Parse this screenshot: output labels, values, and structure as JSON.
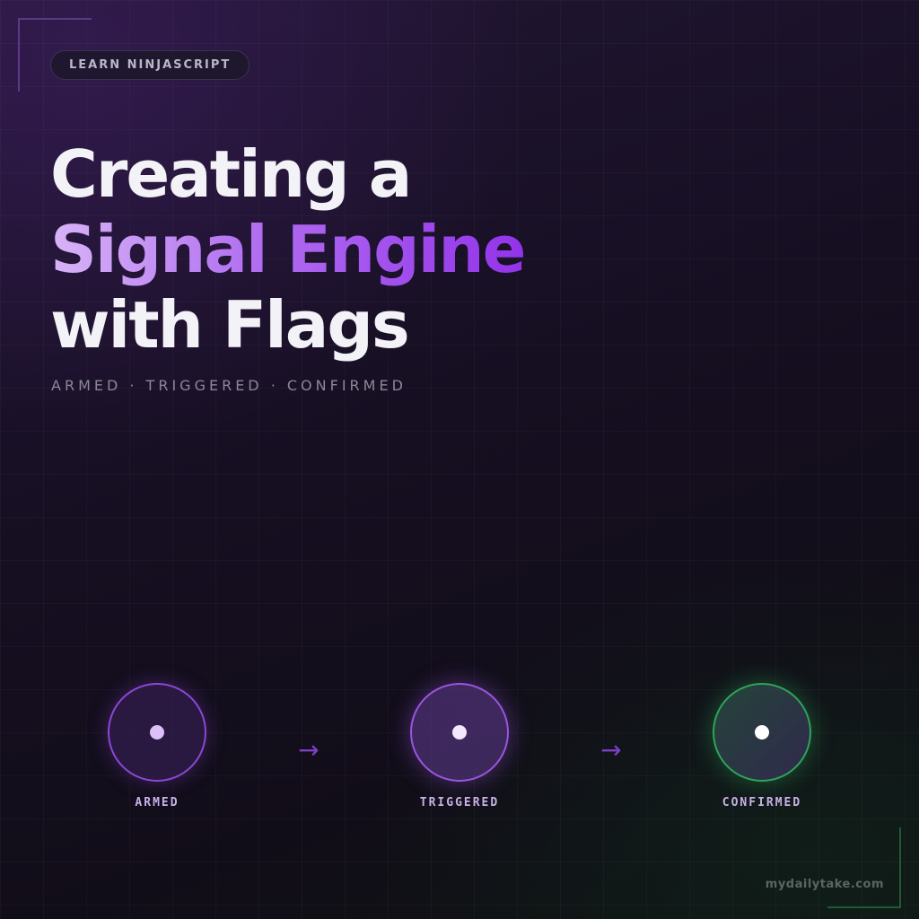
{
  "badge": {
    "label": "LEARN NINJASCRIPT"
  },
  "title": {
    "line1": "Creating a",
    "line2": "Signal Engine",
    "line3": "with Flags"
  },
  "subtitle": "ARMED · TRIGGERED · CONFIRMED",
  "steps": [
    {
      "label": "ARMED",
      "color": "#8b47d6"
    },
    {
      "label": "TRIGGERED",
      "color": "#9a55e0"
    },
    {
      "label": "CONFIRMED",
      "color": "#2fa35a"
    }
  ],
  "arrows": [
    "→",
    "→"
  ],
  "footer": {
    "site": "mydailytake.com"
  },
  "colors": {
    "accent": "#9333ea",
    "accent_light": "#d7b4f7",
    "success": "#2fa35a",
    "background": "#160f22"
  }
}
